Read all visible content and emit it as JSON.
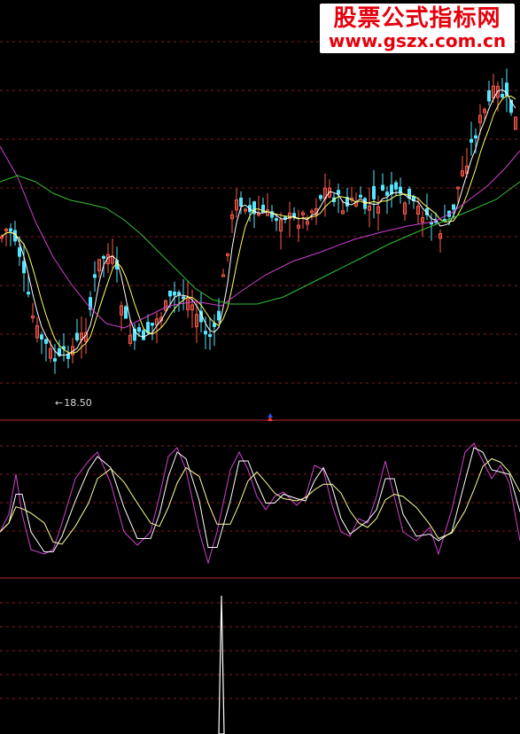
{
  "watermark": {
    "site_name": "股票公式指标网",
    "url": "www.gszx.com.cn"
  },
  "colors": {
    "background": "#000000",
    "panel_border": "#c0282c",
    "grid_dash": "#8a1a1a",
    "candle_up": "#ff5a4a",
    "candle_down": "#54e6ff",
    "ma_short": "#ffffff",
    "ma_mid": "#ffff66",
    "ma_long_purple": "#d040d0",
    "ma_long_green": "#33c033",
    "osc_fast": "#d040d0",
    "osc_mid": "#ffffff",
    "osc_slow": "#ffff99",
    "signal": "#ffffff",
    "marker": "#2050ff"
  },
  "chart_data": [
    {
      "type": "candlestick",
      "title": "",
      "annotations": [
        {
          "text": "18.50",
          "arrow": "←"
        }
      ],
      "grid": true,
      "series": [
        {
          "kind": "candles",
          "count": 117
        },
        {
          "kind": "moving-average",
          "color": "white"
        },
        {
          "kind": "moving-average",
          "color": "yellow"
        },
        {
          "kind": "moving-average",
          "color": "purple"
        },
        {
          "kind": "moving-average",
          "color": "green"
        }
      ]
    },
    {
      "type": "line",
      "title": "",
      "grid": true,
      "series": [
        {
          "color": "purple"
        },
        {
          "color": "white"
        },
        {
          "color": "yellow"
        }
      ]
    },
    {
      "type": "bar",
      "title": "",
      "grid": true,
      "description_values": [
        {
          "index": 49,
          "value": 1
        }
      ]
    }
  ],
  "low_price_label": {
    "arrow": "←",
    "value": "18.50"
  }
}
